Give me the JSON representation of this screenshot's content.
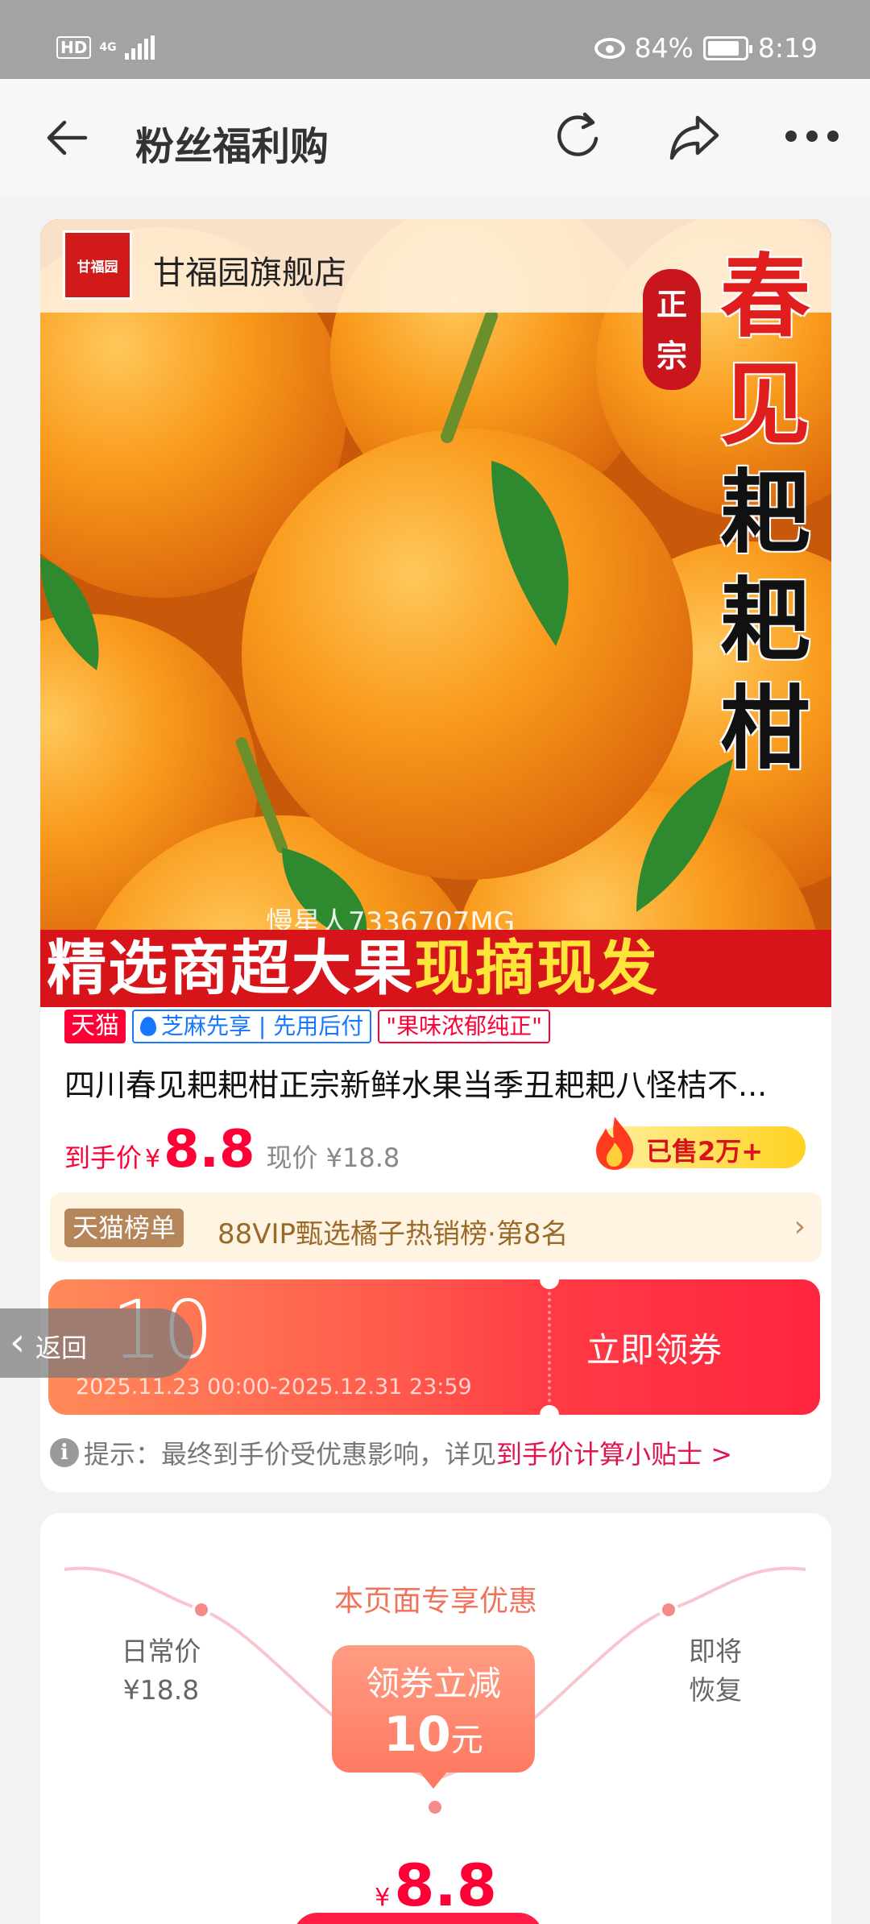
{
  "status_bar": {
    "hd": "HD",
    "network": "4G",
    "battery_percent": "84%",
    "time": "8:19"
  },
  "nav": {
    "title": "粉丝福利购"
  },
  "product": {
    "store_name": "甘福园旗舰店",
    "store_logo_text": "甘福园",
    "image_badge": "正宗",
    "image_title_red": "春",
    "image_title_red2": "见",
    "image_title_black": "耙耙柑",
    "watermark": "慢星人7336707MG",
    "banner_white": "精选商超大果",
    "banner_yellow": "现摘现发",
    "tags": {
      "tmall": "天猫",
      "zhima": "芝麻先享 | 先用后付",
      "quote": "\"果味浓郁纯正\""
    },
    "title": "四川春见耙耙柑正宗新鲜水果当季丑耙耙八怪桔不...",
    "price_label": "到手价",
    "currency": "¥",
    "price": "8.8",
    "current_price": "现价 ¥18.8",
    "sold": "已售2万+",
    "rank_badge": "天猫榜单",
    "rank_text": "88VIP甄选橘子热销榜·第8名",
    "rank_chevron": "›"
  },
  "coupon": {
    "amount": "10",
    "date_range": "2025.11.23 00:00-2025.12.31 23:59",
    "claim_label": "立即领券"
  },
  "tip": {
    "icon": "i",
    "text": "提示：最终到手价受优惠影响，详见",
    "link": "到手价计算小贴士 >"
  },
  "float_back": {
    "arrow": "‹",
    "label": "返回"
  },
  "exclusive": {
    "title": "本页面专享优惠",
    "daily_label": "日常价",
    "daily_price": "¥18.8",
    "restore_line1": "即将",
    "restore_line2": "恢复",
    "offer_line1": "领券立减",
    "offer_amount": "10",
    "offer_unit": "元",
    "final_currency": "¥",
    "final_price": "8.8"
  },
  "colors": {
    "accent": "#ff0036",
    "coupon_start": "#ff8a5a",
    "coupon_end": "#ff2540",
    "rank_bg": "#fff4e2"
  }
}
